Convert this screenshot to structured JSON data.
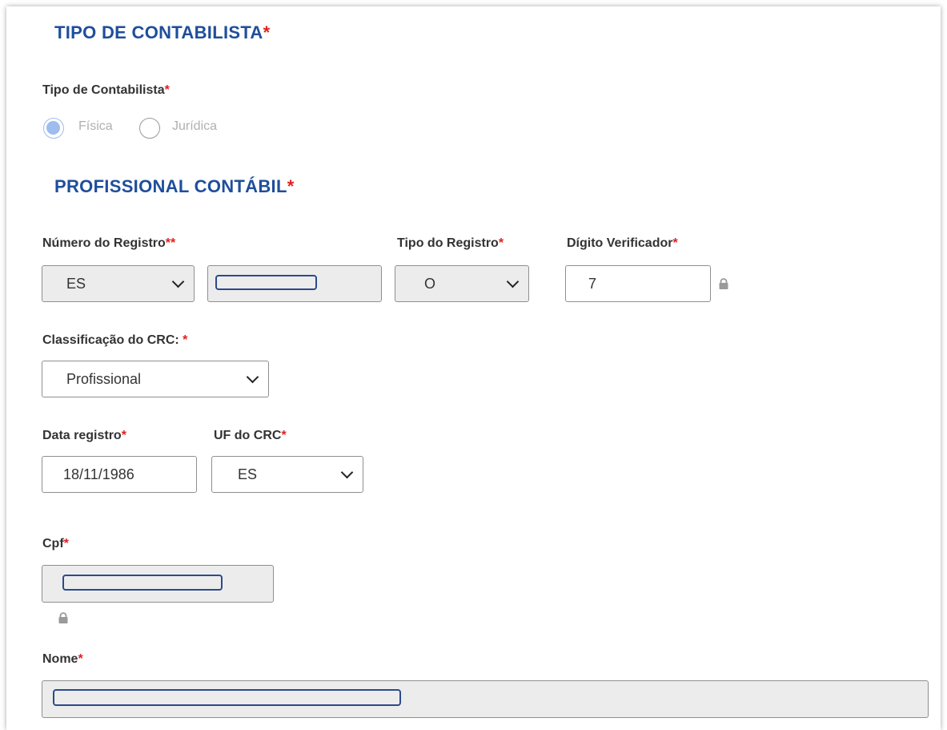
{
  "sections": {
    "tipo": {
      "title": "TIPO DE CONTABILISTA",
      "star": "*"
    },
    "profissional": {
      "title": "PROFISSIONAL CONTÁBIL",
      "star": "*"
    }
  },
  "tipo_contabilista": {
    "label": "Tipo de Contabilista",
    "star": "*",
    "options": [
      "Física",
      "Jurídica"
    ],
    "selected": "Física"
  },
  "registro": {
    "numero_label": "Número do Registro",
    "numero_star": "**",
    "uf_value": "ES",
    "tipo_label": "Tipo do Registro",
    "tipo_star": "*",
    "tipo_value": "O",
    "digito_label": "Dígito Verificador",
    "digito_star": "*",
    "digito_value": "7"
  },
  "classificacao": {
    "label": "Classificação do CRC:",
    "star": "*",
    "value": "Profissional"
  },
  "data_registro": {
    "label": "Data registro",
    "star": "*",
    "value": "18/11/1986"
  },
  "uf_crc": {
    "label": "UF do CRC",
    "star": "*",
    "value": "ES"
  },
  "cpf": {
    "label": "Cpf",
    "star": "*"
  },
  "nome": {
    "label": "Nome",
    "star": "*"
  },
  "colors": {
    "accent": "#1f4e9b",
    "required": "#e02020",
    "radio_selected": "#9ebcf0",
    "disabled_bg": "#ececec"
  },
  "icons": {
    "lock": "lock-icon",
    "dropdown": "chevron-down-icon"
  }
}
